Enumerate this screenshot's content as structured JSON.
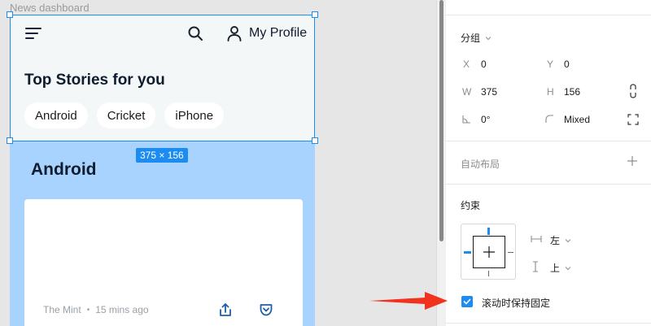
{
  "canvas": {
    "frame_label": "News dashboard",
    "size_badge": "375 × 156"
  },
  "header": {
    "profile_label": "My Profile",
    "title": "Top Stories for you",
    "chips": [
      "Android",
      "Cricket",
      "iPhone"
    ]
  },
  "section": {
    "title": "Android",
    "story": {
      "source": "The Mint",
      "separator": "•",
      "time": "15 mins ago"
    }
  },
  "panel": {
    "group": {
      "title": "分组"
    },
    "x": {
      "label": "X",
      "value": "0"
    },
    "y": {
      "label": "Y",
      "value": "0"
    },
    "w": {
      "label": "W",
      "value": "375"
    },
    "h": {
      "label": "H",
      "value": "156"
    },
    "rotation": {
      "value": "0°"
    },
    "radius": {
      "value": "Mixed"
    },
    "auto_layout": {
      "title": "自动布局"
    },
    "constraints": {
      "title": "约束",
      "horizontal": "左",
      "vertical": "上"
    },
    "fix_on_scroll": {
      "label": "滚动时保持固定",
      "checked": true
    }
  },
  "colors": {
    "selection": "#1d8cf0",
    "section_bg": "#a9d3ff",
    "header_bg": "#f3f7f7",
    "arrow": "#f0321e"
  }
}
